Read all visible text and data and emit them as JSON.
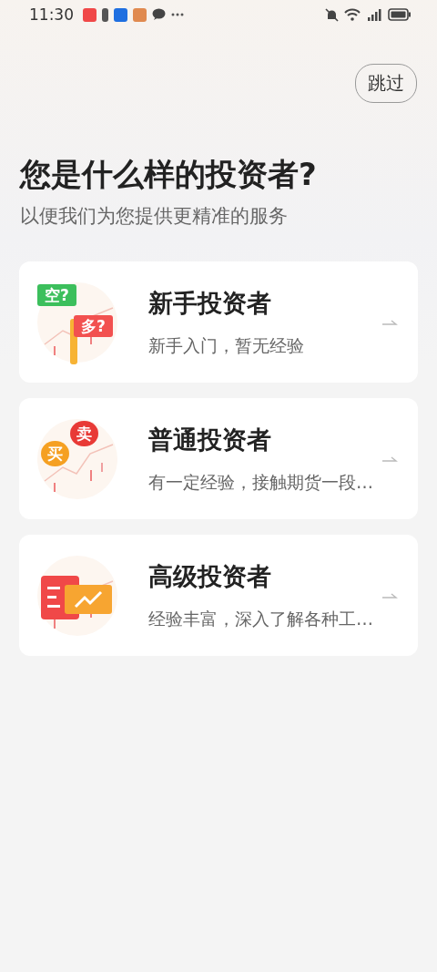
{
  "status_bar": {
    "time": "11:30"
  },
  "skip_button": {
    "label": "跳过"
  },
  "heading": {
    "title": "您是什么样的投资者?",
    "subtitle": "以便我们为您提供更精准的服务"
  },
  "options": [
    {
      "kind": "signs",
      "title": "新手投资者",
      "description": "新手入门，暂无经验",
      "tags": [
        "空?",
        "多?"
      ]
    },
    {
      "kind": "bubbles",
      "title": "普通投资者",
      "description": "有一定经验，接触期货一段…",
      "tags": [
        "卖",
        "买"
      ]
    },
    {
      "kind": "board",
      "title": "高级投资者",
      "description": "经验丰富，深入了解各种工…"
    }
  ]
}
